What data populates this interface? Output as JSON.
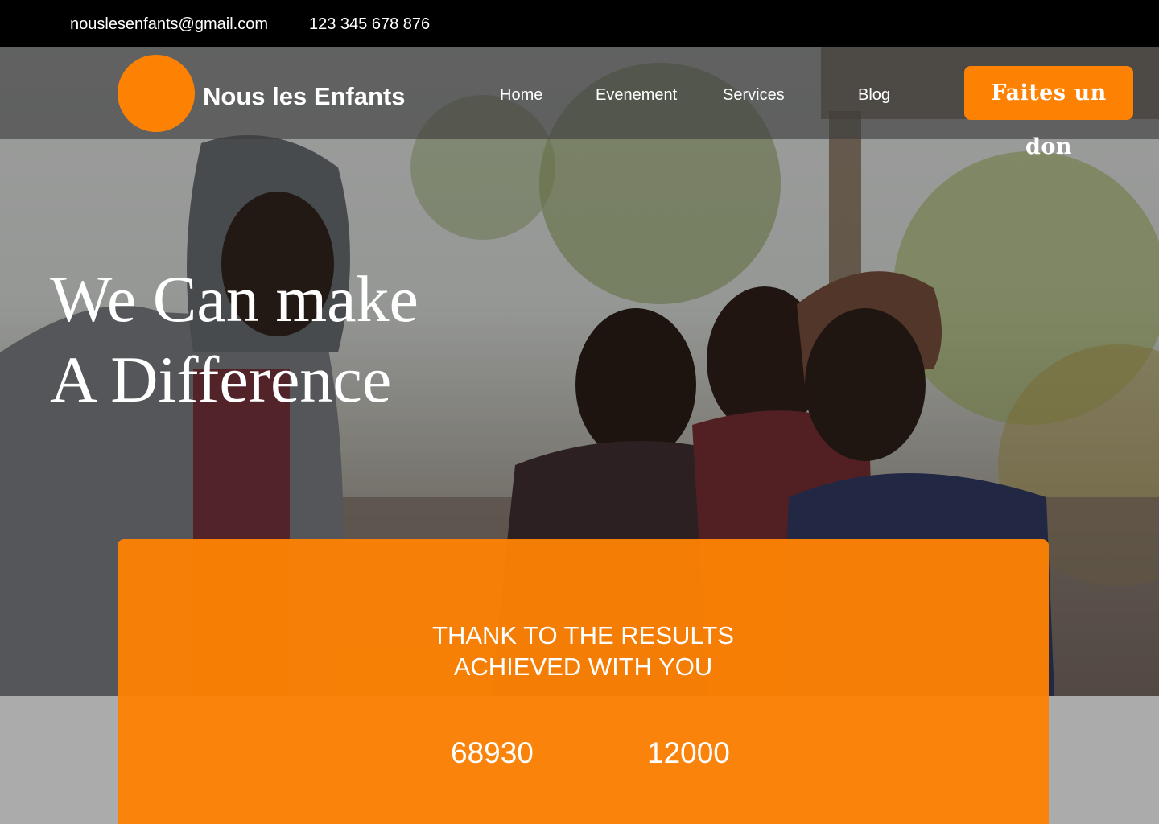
{
  "topbar": {
    "email": "nouslesenfants@gmail.com",
    "phone": "123 345 678 876"
  },
  "brand": {
    "name": "Nous les Enfants",
    "logo_color": "#fd8204"
  },
  "nav": {
    "items": [
      {
        "label": "Home"
      },
      {
        "label": "Evenement"
      },
      {
        "label": "Services"
      },
      {
        "label": "Blog"
      }
    ],
    "donate_label": "Faites un don"
  },
  "hero": {
    "headline_line1": "We Can make",
    "headline_line2": "A Difference",
    "image": "photo of four children smiling outdoors"
  },
  "results": {
    "title_line1": "THANK TO THE RESULTS",
    "title_line2": "ACHIEVED WITH YOU",
    "stats": [
      "68930",
      "12000"
    ]
  },
  "colors": {
    "accent": "#fd8204",
    "topbar": "#000000",
    "text": "#ffffff"
  }
}
